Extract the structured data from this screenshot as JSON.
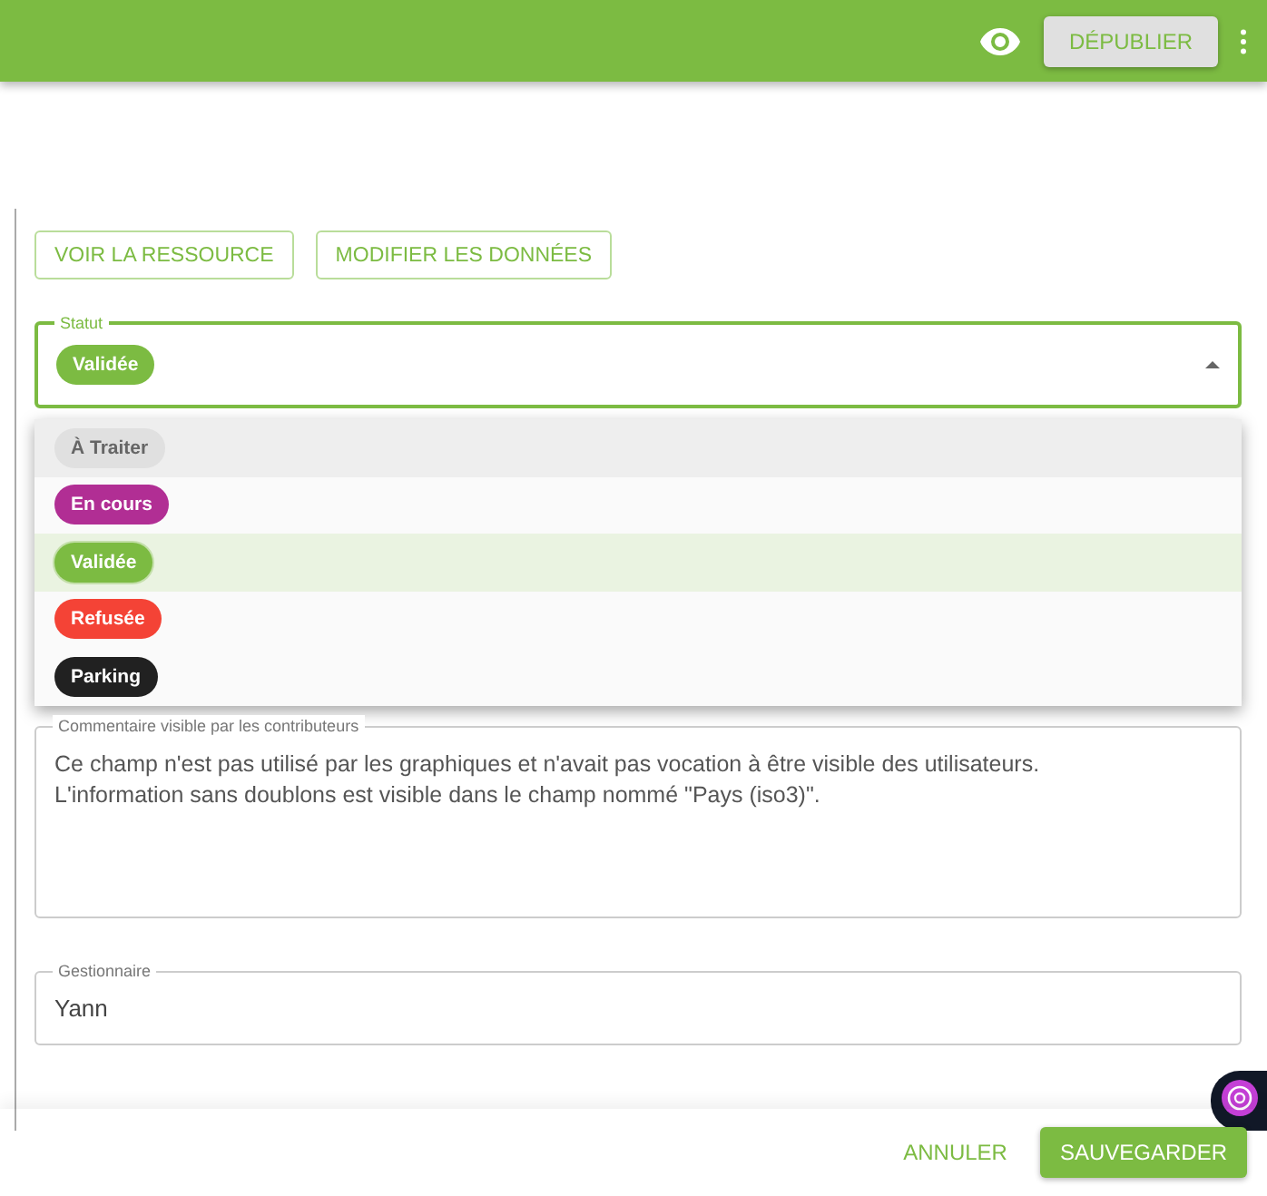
{
  "top_bar": {
    "publish_button": "DÉPUBLIER"
  },
  "actions": [
    "VOIR LA RESSOURCE",
    "MODIFIER LES DONNÉES"
  ],
  "status_field": {
    "label": "Statut",
    "value": {
      "label": "Validée",
      "color": "#7cbb42"
    },
    "expanded": true,
    "options": [
      {
        "label": "À Traiter",
        "color": "#e0e0e0",
        "selected": false,
        "highlighted": true
      },
      {
        "label": "En cours",
        "color": "#b12e94",
        "selected": false,
        "highlighted": false
      },
      {
        "label": "Validée",
        "color": "#7cbb42",
        "selected": true,
        "highlighted": false
      },
      {
        "label": "Refusée",
        "color": "#f44336",
        "selected": false,
        "highlighted": false
      },
      {
        "label": "Parking",
        "color": "#212121",
        "selected": false,
        "highlighted": false
      }
    ]
  },
  "comment_field": {
    "label": "Commentaire visible par les contributeurs",
    "lines": [
      "Ce champ n'est pas utilisé par les graphiques et n'avait pas vocation à être visible des utilisateurs.",
      "L'information sans doublons est visible dans le champ nommé \"Pays (iso3)\"."
    ]
  },
  "manager_field": {
    "label": "Gestionnaire",
    "value": "Yann"
  },
  "footer": {
    "cancel": "ANNULER",
    "save": "SAUVEGARDER"
  }
}
